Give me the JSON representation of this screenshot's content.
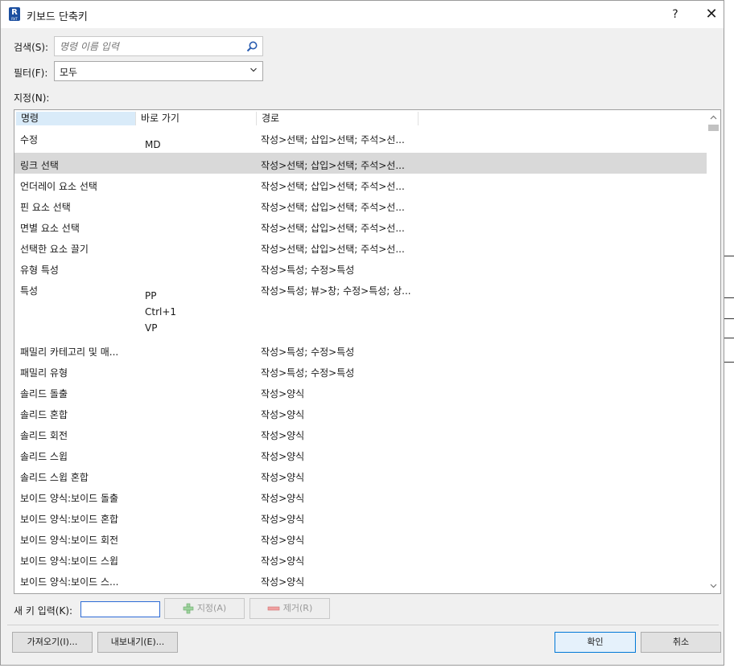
{
  "window": {
    "title": "키보드 단축키",
    "app_icon_letter": "R",
    "app_icon_sub": "RVT",
    "help": "?",
    "close": "✕"
  },
  "search": {
    "label": "검색(S):",
    "placeholder": "명령 이름 입력"
  },
  "filter": {
    "label": "필터(F):",
    "value": "모두"
  },
  "assign_label": "지정(N):",
  "columns": [
    "명령",
    "바로 가기",
    "경로"
  ],
  "rows": [
    {
      "name": "수정",
      "shortcuts": [
        "MD"
      ],
      "path": "작성>선택; 삽입>선택; 주석>선..."
    },
    {
      "name": "링크 선택",
      "shortcuts": [],
      "path": "작성>선택; 삽입>선택; 주석>선...",
      "selected": true
    },
    {
      "name": "언더레이 요소 선택",
      "shortcuts": [],
      "path": "작성>선택; 삽입>선택; 주석>선..."
    },
    {
      "name": "핀 요소 선택",
      "shortcuts": [],
      "path": "작성>선택; 삽입>선택; 주석>선..."
    },
    {
      "name": "면별 요소 선택",
      "shortcuts": [],
      "path": "작성>선택; 삽입>선택; 주석>선..."
    },
    {
      "name": "선택한 요소 끌기",
      "shortcuts": [],
      "path": "작성>선택; 삽입>선택; 주석>선..."
    },
    {
      "name": "유형 특성",
      "shortcuts": [],
      "path": "작성>특성; 수정>특성"
    },
    {
      "name": "특성",
      "shortcuts": [
        "PP",
        "Ctrl+1",
        "VP"
      ],
      "path": "작성>특성; 뷰>창; 수정>특성; 상..."
    },
    {
      "name": "패밀리 카테고리 및 매...",
      "shortcuts": [],
      "path": "작성>특성; 수정>특성"
    },
    {
      "name": "패밀리 유형",
      "shortcuts": [],
      "path": "작성>특성; 수정>특성"
    },
    {
      "name": "솔리드 돌출",
      "shortcuts": [],
      "path": "작성>양식"
    },
    {
      "name": "솔리드 혼합",
      "shortcuts": [],
      "path": "작성>양식"
    },
    {
      "name": "솔리드 회전",
      "shortcuts": [],
      "path": "작성>양식"
    },
    {
      "name": "솔리드 스윕",
      "shortcuts": [],
      "path": "작성>양식"
    },
    {
      "name": "솔리드 스윕 혼합",
      "shortcuts": [],
      "path": "작성>양식"
    },
    {
      "name": "보이드 양식:보이드 돌출",
      "shortcuts": [],
      "path": "작성>양식"
    },
    {
      "name": "보이드 양식:보이드 혼합",
      "shortcuts": [],
      "path": "작성>양식"
    },
    {
      "name": "보이드 양식:보이드 회전",
      "shortcuts": [],
      "path": "작성>양식"
    },
    {
      "name": "보이드 양식:보이드 스윕",
      "shortcuts": [],
      "path": "작성>양식"
    },
    {
      "name": "보이드 양식:보이드 스...",
      "shortcuts": [],
      "path": "작성>양식"
    }
  ],
  "new_key": {
    "label": "새 키 입력(K):",
    "value": ""
  },
  "buttons": {
    "assign": "지정(A)",
    "remove": "제거(R)",
    "import": "가져오기(I)...",
    "export": "내보내기(E)...",
    "ok": "확인",
    "cancel": "취소"
  },
  "colors": {
    "selected_row": "#d9d9d9",
    "sorted_header": "#d9ebf9",
    "accent": "#0078d7",
    "add_icon": "#5cb85c",
    "remove_icon": "#e06060"
  }
}
